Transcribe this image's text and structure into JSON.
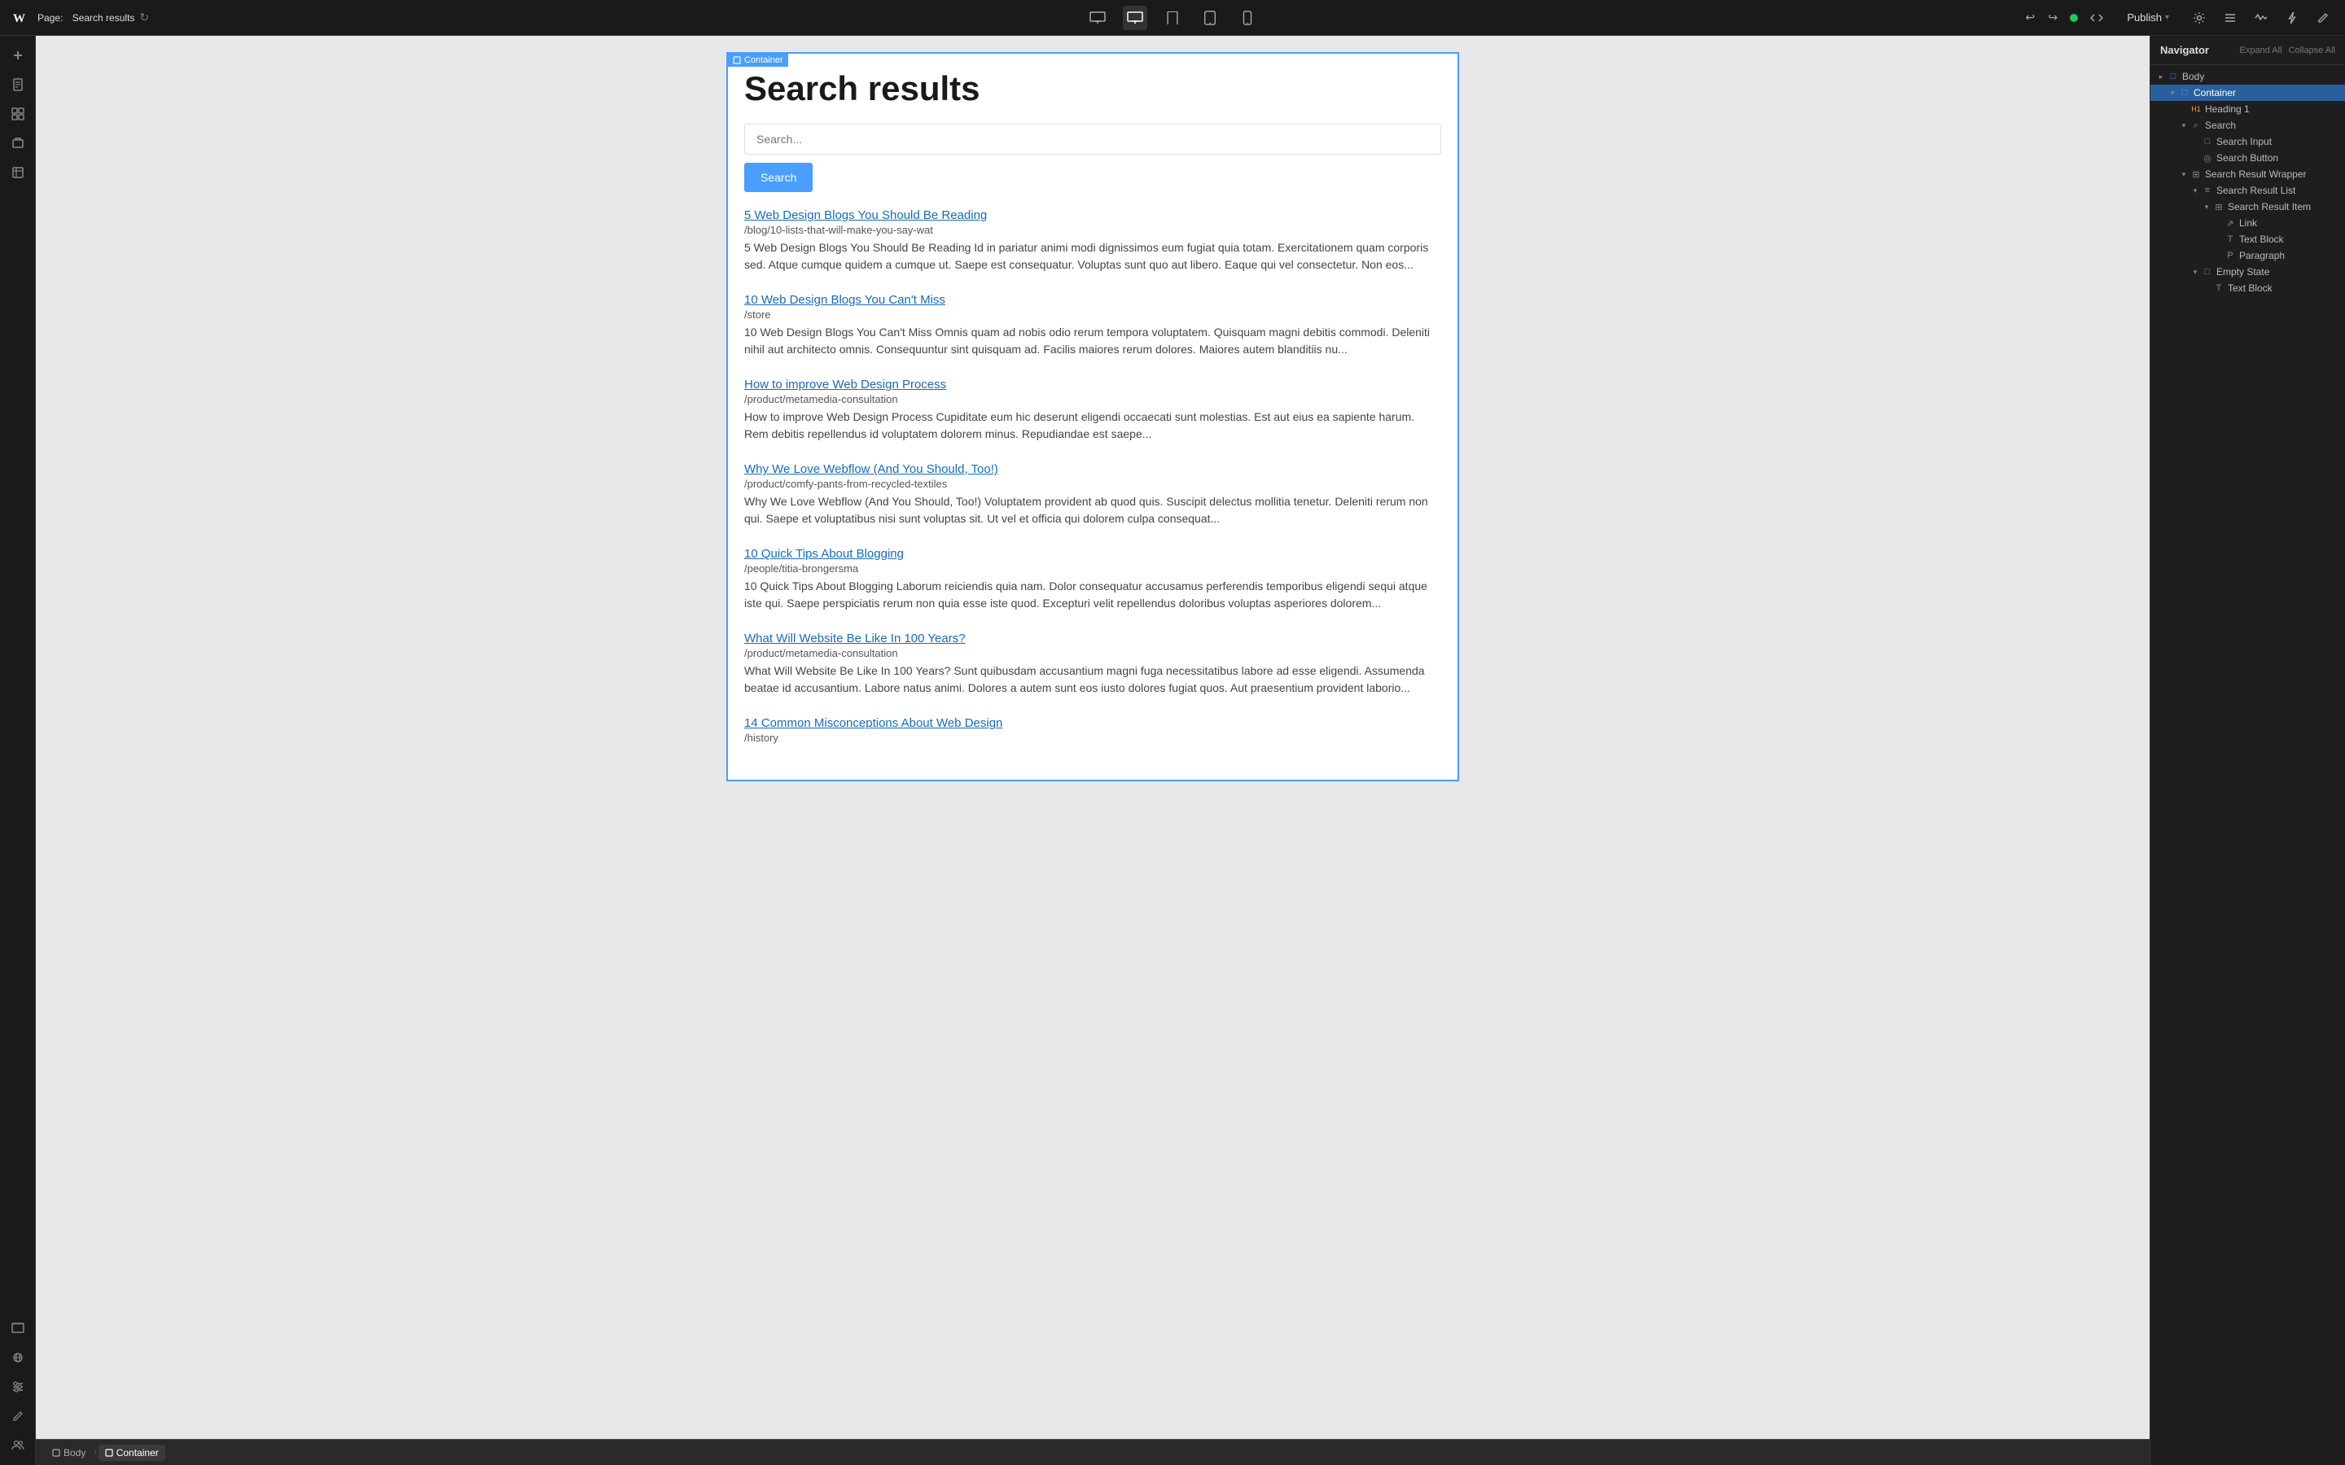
{
  "topbar": {
    "logo": "W",
    "page_label": "Page:",
    "page_name": "Search results",
    "devices": [
      {
        "id": "desktop-large",
        "icon": "⬜",
        "active": false
      },
      {
        "id": "desktop",
        "icon": "🖥",
        "active": true
      },
      {
        "id": "tablet-landscape",
        "icon": "⬜",
        "active": false
      },
      {
        "id": "tablet",
        "icon": "⬜",
        "active": false
      },
      {
        "id": "mobile",
        "icon": "📱",
        "active": false
      }
    ],
    "publish_label": "Publish",
    "undo": "↩",
    "redo": "↪"
  },
  "left_sidebar": {
    "icons": [
      {
        "name": "add",
        "symbol": "+"
      },
      {
        "name": "pages",
        "symbol": "📄"
      },
      {
        "name": "components",
        "symbol": "⊞"
      },
      {
        "name": "assets",
        "symbol": "🗂"
      },
      {
        "name": "cms",
        "symbol": "📋"
      }
    ],
    "bottom_icons": [
      {
        "name": "preview",
        "symbol": "⬜"
      },
      {
        "name": "grid",
        "symbol": "⊞"
      },
      {
        "name": "sliders",
        "symbol": "≡"
      },
      {
        "name": "editor",
        "symbol": "✎"
      },
      {
        "name": "team",
        "symbol": "👥"
      }
    ]
  },
  "canvas": {
    "container_label": "Container",
    "page_title": "Search results",
    "search_placeholder": "Search...",
    "search_button": "Search",
    "results": [
      {
        "title": "5 Web Design Blogs You Should Be Reading",
        "url": "/blog/10-lists-that-will-make-you-say-wat",
        "description": "5 Web Design Blogs You Should Be Reading Id in pariatur animi modi dignissimos eum fugiat quia totam. Exercitationem quam corporis sed. Atque cumque quidem a cumque ut. Saepe est consequatur. Voluptas sunt quo aut libero. Eaque qui vel consectetur. Non eos..."
      },
      {
        "title": "10 Web Design Blogs You Can't Miss",
        "url": "/store",
        "description": "10 Web Design Blogs You Can't Miss Omnis quam ad nobis odio rerum tempora voluptatem. Quisquam magni debitis commodi. Deleniti nihil aut architecto omnis. Consequuntur sint quisquam ad. Facilis maiores rerum dolores. Maiores autem blanditiis nu..."
      },
      {
        "title": "How to improve Web Design Process",
        "url": "/product/metamedia-consultation",
        "description": "How to improve Web Design Process Cupiditate eum hic deserunt eligendi occaecati sunt molestias. Est aut eius ea sapiente harum. Rem debitis repellendus id voluptatem dolorem minus. Repudiandae est saepe..."
      },
      {
        "title": "Why We Love Webflow (And You Should, Too!)",
        "url": "/product/comfy-pants-from-recycled-textiles",
        "description": "Why We Love Webflow (And You Should, Too!) Voluptatem provident ab quod quis. Suscipit delectus mollitia tenetur. Deleniti rerum non qui. Saepe et voluptatibus nisi sunt voluptas sit. Ut vel et officia qui dolorem culpa consequat..."
      },
      {
        "title": "10 Quick Tips About Blogging",
        "url": "/people/titia-brongersma",
        "description": "10 Quick Tips About Blogging Laborum reiciendis quia nam. Dolor consequatur accusamus perferendis temporibus eligendi sequi atque iste qui. Saepe perspiciatis rerum non quia esse iste quod. Excepturi velit repellendus doloribus voluptas asperiores dolorem..."
      },
      {
        "title": "What Will Website Be Like In 100 Years?",
        "url": "/product/metamedia-consultation",
        "description": "What Will Website Be Like In 100 Years? Sunt quibusdam accusantium magni fuga necessitatibus labore ad esse eligendi. Assumenda beatae id accusantium. Labore natus animi. Dolores a autem sunt eos iusto dolores fugiat quos. Aut praesentium provident laborio..."
      },
      {
        "title": "14 Common Misconceptions About Web Design",
        "url": "/history",
        "description": ""
      }
    ]
  },
  "navigator": {
    "title": "Navigator",
    "expand_all": "Expand All",
    "collapse_all": "Collapse All",
    "tree": [
      {
        "id": "body",
        "label": "Body",
        "level": 0,
        "icon": "container",
        "arrow": "right",
        "selected": false
      },
      {
        "id": "container",
        "label": "Container",
        "level": 1,
        "icon": "container",
        "arrow": "down",
        "selected": true
      },
      {
        "id": "heading1",
        "label": "Heading 1",
        "level": 2,
        "icon": "heading",
        "arrow": "empty",
        "selected": false
      },
      {
        "id": "search",
        "label": "Search",
        "level": 2,
        "icon": "search",
        "arrow": "down",
        "selected": false
      },
      {
        "id": "search-input",
        "label": "Search Input",
        "level": 3,
        "icon": "input",
        "arrow": "empty",
        "selected": false
      },
      {
        "id": "search-button",
        "label": "Search Button",
        "level": 3,
        "icon": "button",
        "arrow": "empty",
        "selected": false
      },
      {
        "id": "search-result-wrapper",
        "label": "Search Result Wrapper",
        "level": 2,
        "icon": "wrapper",
        "arrow": "down",
        "selected": false
      },
      {
        "id": "search-result-list",
        "label": "Search Result List",
        "level": 3,
        "icon": "list",
        "arrow": "down",
        "selected": false
      },
      {
        "id": "search-result-item",
        "label": "Search Result Item",
        "level": 4,
        "icon": "item",
        "arrow": "down",
        "selected": false
      },
      {
        "id": "link",
        "label": "Link",
        "level": 5,
        "icon": "link",
        "arrow": "empty",
        "selected": false
      },
      {
        "id": "text-block",
        "label": "Text Block",
        "level": 5,
        "icon": "text",
        "arrow": "empty",
        "selected": false
      },
      {
        "id": "paragraph",
        "label": "Paragraph",
        "level": 5,
        "icon": "para",
        "arrow": "empty",
        "selected": false
      },
      {
        "id": "empty-state",
        "label": "Empty State",
        "level": 3,
        "icon": "empty",
        "arrow": "down",
        "selected": false
      },
      {
        "id": "text-block-2",
        "label": "Text Block",
        "level": 4,
        "icon": "text",
        "arrow": "empty",
        "selected": false
      }
    ]
  },
  "bottom_bar": {
    "items": [
      {
        "label": "Body",
        "icon": "body"
      },
      {
        "label": "Container",
        "icon": "container"
      }
    ]
  }
}
